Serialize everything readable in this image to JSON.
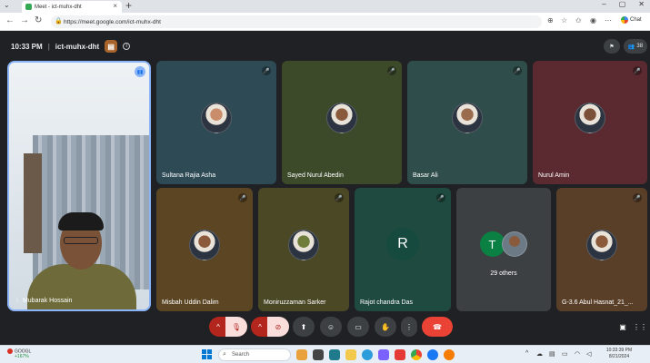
{
  "browser": {
    "tab_title": "Meet - ict-muhx-dht",
    "url": "https://meet.google.com/ict-muhx-dht",
    "chat_label": "Chat"
  },
  "meet": {
    "time": "10:33 PM",
    "separator": "|",
    "meeting_code": "ict-muhx-dht",
    "participant_count": "38",
    "self": {
      "name": "Mubarak Hossain"
    },
    "participants": [
      {
        "name": "Sultana Rajia Asha",
        "bg": "#2d4a55"
      },
      {
        "name": "Sayed Nurul Abedin",
        "bg": "#3d4a2a"
      },
      {
        "name": "Basar Ali",
        "bg": "#2f4d4a"
      },
      {
        "name": "Nurul Amin",
        "bg": "#5a2a30"
      },
      {
        "name": "Misbah Uddin Dalim",
        "bg": "#5b4523"
      },
      {
        "name": "Moniruzzaman Sarker",
        "bg": "#4b4826"
      },
      {
        "name": "Rajot chandra Das",
        "bg": "#1f4a40",
        "letter": "R"
      },
      {
        "name": "29 others",
        "bg": "#3c4043",
        "letter": "T"
      },
      {
        "name": "G-3.6 Abul Hasnat_21_...",
        "bg": "#5a3f28"
      }
    ]
  },
  "taskbar": {
    "weather_title": "GOOGL",
    "weather_value": "+167%",
    "search_placeholder": "Search",
    "time": "10:33:39 PM",
    "date": "8/21/2024"
  },
  "colors": {
    "accent": "#8ab4f8",
    "end_call": "#ea4335",
    "mic_off": "#b3261e"
  }
}
